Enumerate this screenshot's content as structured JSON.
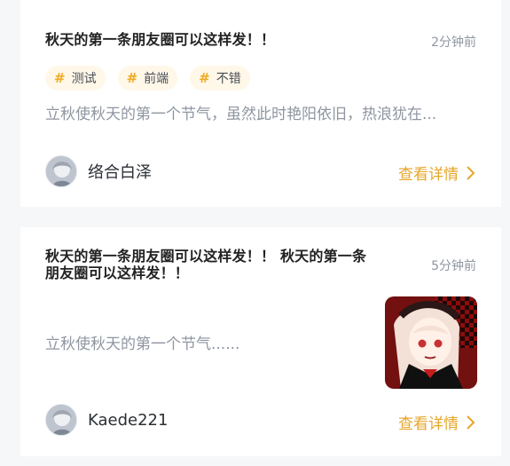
{
  "cards": [
    {
      "title": "秋天的第一条朋友圈可以这样发！！",
      "time": "2分钟前",
      "tags": [
        "测试",
        "前端",
        "不错"
      ],
      "excerpt": "立秋使秋天的第一个节气，虽然此时艳阳依旧，热浪犹在...",
      "author": "络合白泽",
      "detail_label": "查看详情"
    },
    {
      "title": "秋天的第一条朋友圈可以这样发！！ 秋天的第一条朋友圈可以这样发！！",
      "time": "5分钟前",
      "excerpt": "立秋使秋天的第一个节气......",
      "author": "Kaede221",
      "detail_label": "查看详情"
    }
  ],
  "tag_icon": "hash-icon",
  "link_icon": "chevron-right-icon",
  "colors": {
    "accent": "#e6a62a",
    "tag_background": "#fff7e8",
    "page_background": "#f6f7f9",
    "muted_text": "#8f96a1"
  }
}
